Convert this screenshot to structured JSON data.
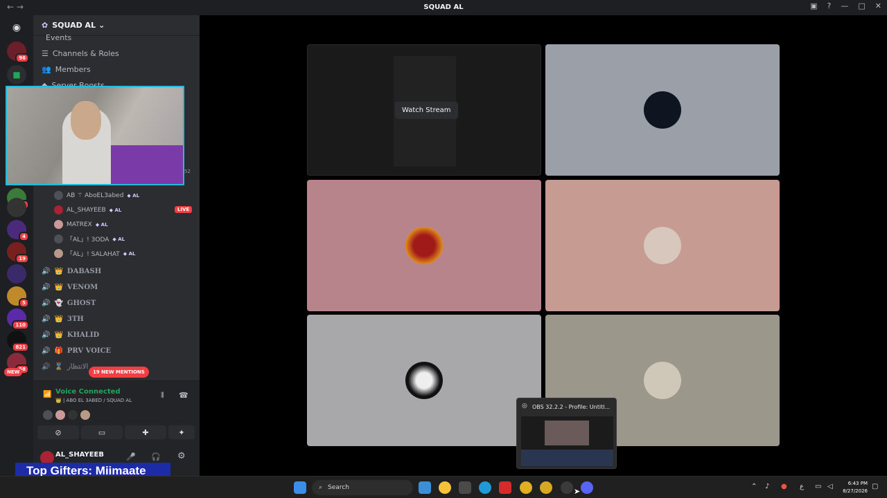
{
  "window": {
    "title": "SQUAD AL",
    "nav": "← →"
  },
  "server": {
    "name": "SQUAD AL"
  },
  "menu": [
    {
      "label": "Events"
    },
    {
      "label": "Channels & Roles"
    },
    {
      "label": "Members"
    },
    {
      "label": "Server Boosts"
    }
  ],
  "members": [
    {
      "name": "AB ⚚ AboEL3abed",
      "tag": "◆ AL"
    },
    {
      "name": "AL_SHAYEEB",
      "tag": "◆ AL"
    },
    {
      "name": "MATREX",
      "tag": "◆ AL"
    },
    {
      "name": "「AL」! 3ODA",
      "tag": "◆ AL"
    },
    {
      "name": "「AL」! SALAHAT",
      "tag": "◆ AL"
    }
  ],
  "live_badge": "LIVE",
  "member_count": "52",
  "voice_channels": [
    {
      "label": "DABASH",
      "emoji": "👑"
    },
    {
      "label": "VENOM",
      "emoji": "👑"
    },
    {
      "label": "GHOST",
      "emoji": "👻"
    },
    {
      "label": "3TH",
      "emoji": "👑"
    },
    {
      "label": "KHALID",
      "emoji": "👑"
    },
    {
      "label": "PRV VOICE",
      "emoji": "🎁"
    },
    {
      "label": "الانتظار",
      "emoji": "⌛"
    }
  ],
  "mentions_pill": "19 NEW MENTIONS",
  "new_pill": "NEW",
  "guild_badges": [
    "96",
    "45",
    "4",
    "19",
    "5",
    "110",
    "821",
    "58"
  ],
  "voice": {
    "status": "Voice Connected",
    "channel": "👑 | ABO EL 3ABED / SQUAD AL"
  },
  "user": {
    "name": "AL_SHAYEEB"
  },
  "overlay": {
    "gifters": "Top Gifters: Miimaate"
  },
  "stage": {
    "watch_stream": "Watch Stream",
    "tile_colors": [
      "#1a1a1a",
      "#9b9fa8",
      "#b8848c",
      "#c69c92",
      "#a8a8aa",
      "#9b978a"
    ]
  },
  "obs": {
    "title": "OBS 32.2.2 - Profile: Untitl..."
  },
  "taskbar": {
    "search_label": "Search",
    "time": "6:43 PM",
    "date": "8/27/2026",
    "lang": "ع"
  },
  "colors": {
    "accent": "#5865f2",
    "danger": "#f23f43",
    "connected": "#23a55a"
  }
}
